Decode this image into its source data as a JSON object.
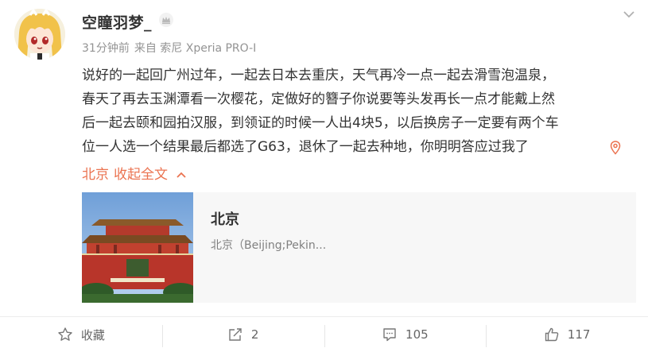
{
  "user": {
    "name": "空瞳羽梦_",
    "avatar_icon": "anime-girl-avatar",
    "badge_icon": "crown-badge-icon"
  },
  "meta": {
    "time": "31分钟前",
    "source": "来自 索尼 Xperia PRO-I"
  },
  "post": {
    "lines": [
      "说好的一起回广州过年，一起去日本去重庆，天气再冷一点一起去滑雪泡温泉，",
      "春天了再去玉渊潭看一次樱花，定做好的簪子你说要等头发再长一点才能戴上然",
      "后一起去颐和园拍汉服，到领证的时候一人出4块5，以后换房子一定要有两个车",
      "位一人选一个结果最后都选了G63，退休了一起去种地，你明明答应过我了"
    ],
    "location_pin_icon": "location-pin-icon"
  },
  "actions": {
    "location": "北京",
    "collapse": "收起全文"
  },
  "card": {
    "title": "北京",
    "subtitle": "北京（Beijing;Pekin..."
  },
  "footer": {
    "favorite_label": "收藏",
    "repost_count": "2",
    "comment_count": "105",
    "like_count": "117"
  },
  "colors": {
    "accent": "#eb7350",
    "text": "#333333",
    "meta": "#939393",
    "card_bg": "#f7f7f7"
  }
}
